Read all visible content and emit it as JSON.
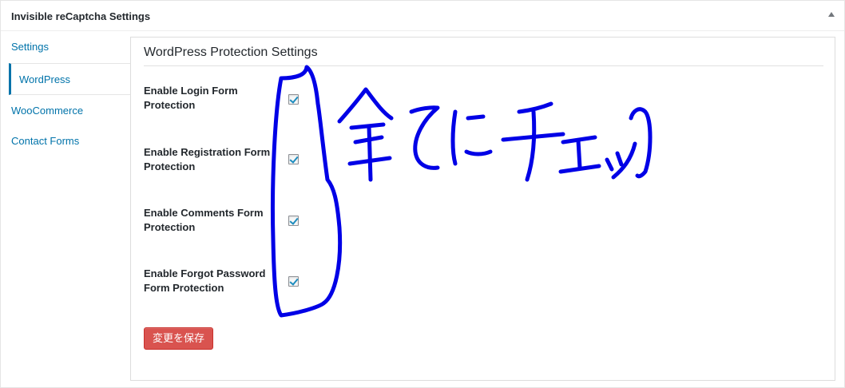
{
  "postbox": {
    "title": "Invisible reCaptcha Settings"
  },
  "tabs": [
    {
      "label": "Settings",
      "active": false
    },
    {
      "label": "WordPress",
      "active": true
    },
    {
      "label": "WooCommerce",
      "active": false
    },
    {
      "label": "Contact Forms",
      "active": false
    }
  ],
  "panel": {
    "title": "WordPress Protection Settings",
    "options": [
      {
        "label": "Enable Login Form Protection",
        "checked": true
      },
      {
        "label": "Enable Registration Form Protection",
        "checked": true
      },
      {
        "label": "Enable Comments Form Protection",
        "checked": true
      },
      {
        "label": "Enable Forgot Password Form Protection",
        "checked": true
      }
    ],
    "save_label": "変更を保存"
  },
  "annotation": {
    "color": "#0000e6",
    "handwritten_text": "全てにチェック"
  },
  "colors": {
    "link": "#0073aa",
    "save_button": "#d9534f",
    "checkmark": "#1e8cbe"
  }
}
